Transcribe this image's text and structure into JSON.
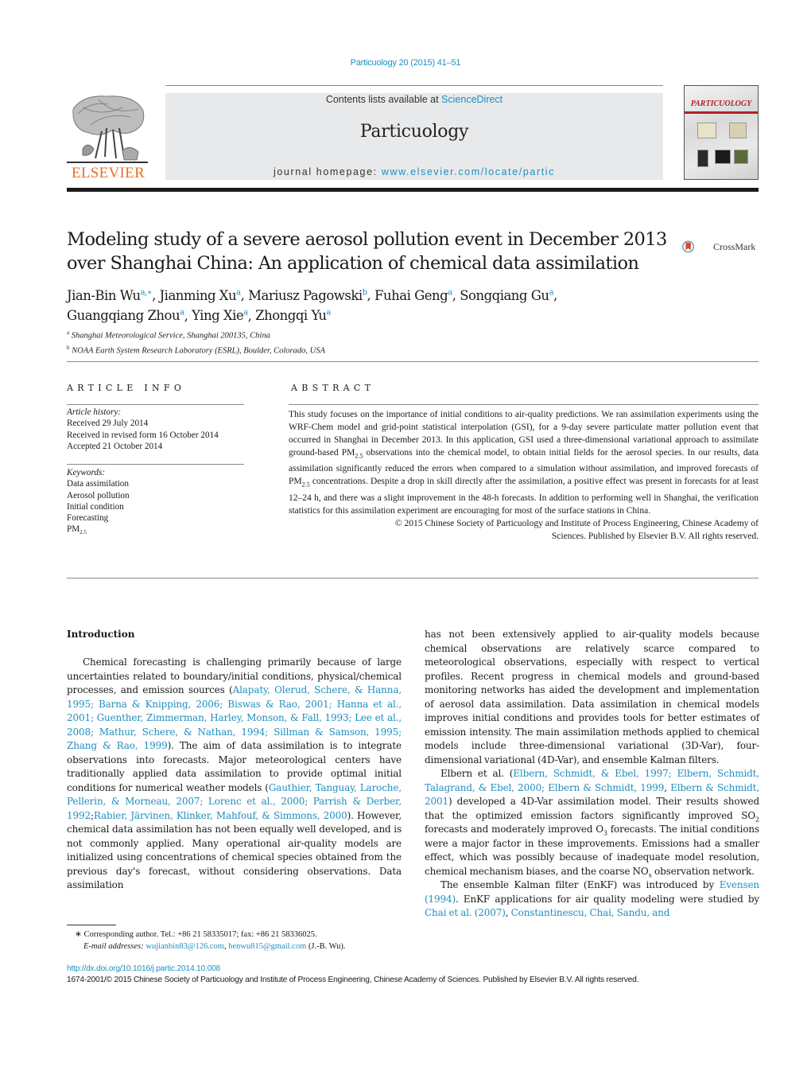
{
  "header": {
    "running_head": "Particuology 20 (2015) 41–51",
    "publisher_wordmark": "ELSEVIER",
    "publisher_logo_icon": "elsevier-tree-icon",
    "contents_prefix": "Contents lists available at ",
    "contents_link": "ScienceDirect",
    "journal_name": "Particuology",
    "homepage_prefix": "journal homepage: ",
    "homepage_link": "www.elsevier.com/locate/partic",
    "cover_title": "PARTICUOLOGY",
    "crossmark_label": "CrossMark"
  },
  "article": {
    "title_line1": "Modeling study of a severe aerosol pollution event in December 2013",
    "title_line2": "over Shanghai China: An application of chemical data assimilation",
    "authors": [
      {
        "name": "Jian-Bin Wu",
        "sup": "a,∗",
        "sep": ", "
      },
      {
        "name": "Jianming Xu",
        "sup": "a",
        "sep": ", "
      },
      {
        "name": "Mariusz Pagowski",
        "sup": "b",
        "sep": ", "
      },
      {
        "name": "Fuhai Geng",
        "sup": "a",
        "sep": ", "
      },
      {
        "name": "Songqiang Gu",
        "sup": "a",
        "sep": ","
      },
      {
        "name": "Guangqiang Zhou",
        "sup": "a",
        "sep": ", "
      },
      {
        "name": "Ying Xie",
        "sup": "a",
        "sep": ", "
      },
      {
        "name": "Zhongqi Yu",
        "sup": "a",
        "sep": ""
      }
    ],
    "affiliations": [
      {
        "mark": "a",
        "text": "Shanghai Meteorological Service, Shanghai 200135, China"
      },
      {
        "mark": "b",
        "text": "NOAA Earth System Research Laboratory (ESRL), Boulder, Colorado, USA"
      }
    ]
  },
  "article_info": {
    "heading": "ARTICLE INFO",
    "history_label": "Article history:",
    "history": [
      "Received 29 July 2014",
      "Received in revised form 16 October 2014",
      "Accepted 21 October 2014"
    ],
    "keywords_label": "Keywords:",
    "keywords": [
      "Data assimilation",
      "Aerosol pollution",
      "Initial condition",
      "Forecasting"
    ],
    "keyword_pm_base": "PM",
    "keyword_pm_sub": "2.5"
  },
  "abstract": {
    "heading": "ABSTRACT",
    "p1": "This study focuses on the importance of initial conditions to air-quality predictions. We ran assimilation experiments using the WRF-Chem model and grid-point statistical interpolation (GSI), for a 9-day severe particulate matter pollution event that occurred in Shanghai in December 2013. In this application, GSI used a three-dimensional variational approach to assimilate ground-based PM",
    "sub1": "2.5",
    "p2": " observations into the chemical model, to obtain initial fields for the aerosol species. In our results, data assimilation significantly reduced the errors when compared to a simulation without assimilation, and improved forecasts of PM",
    "sub2": "2.5",
    "p3": " concentrations. Despite a drop in skill directly after the assimilation, a positive effect was present in forecasts for at least 12–24 h, and there was a slight improvement in the 48-h forecasts. In addition to performing well in Shanghai, the verification statistics for this assimilation experiment are encouraging for most of the surface stations in China.",
    "copyright_line1": "© 2015 Chinese Society of Particuology and Institute of Process Engineering, Chinese Academy of",
    "copyright_line2": "Sciences. Published by Elsevier B.V. All rights reserved."
  },
  "body": {
    "section_heading": "Introduction",
    "left": {
      "t1": "Chemical forecasting is challenging primarily because of large uncertainties related to boundary/initial conditions, physical/chemical processes, and emission sources (",
      "c1": "Alapaty, Olerud, Schere, & Hanna, 1995; Barna & Knipping, 2006; Biswas & Rao, 2001; Hanna et al., 2001; Guenther, Zimmerman, Harley, Monson, & Fall, 1993; Lee et al., 2008; Mathur, Schere, & Nathan, 1994; Sillman & Samson, 1995; Zhang & Rao, 1999",
      "t2": "). The aim of data assimilation is to integrate observations into forecasts. Major meteorological centers have traditionally applied data assimilation to provide optimal initial conditions for numerical weather models (",
      "c2": "Gauthier, Tanguay, Laroche, Pellerin, & Morneau, 2007; Lorenc et al., 2000; Parrish & Derber, 1992",
      "t3": ";",
      "c3": "Rabier, Järvinen, Klinker, Mahfouf, & Simmons, 2000",
      "t4": "). However, chemical data assimilation has not been equally well developed, and is not commonly applied. Many operational air-quality models are initialized using concentrations of chemical species obtained from the previous day's forecast, without considering observations. Data assimilation"
    },
    "right": {
      "p1": "has not been extensively applied to air-quality models because chemical observations are relatively scarce compared to meteorological observations, especially with respect to vertical profiles. Recent progress in chemical models and ground-based monitoring networks has aided the development and implementation of aerosol data assimilation. Data assimilation in chemical models improves initial conditions and provides tools for better estimates of emission intensity. The main assimilation methods applied to chemical models include three-dimensional variational (3D-Var), four-dimensional variational (4D-Var), and ensemble Kalman filters.",
      "p2_t1": "Elbern et al. (",
      "p2_c1": "Elbern, Schmidt, & Ebel, 1997; Elbern, Schmidt, Talagrand, & Ebel, 2000; Elbern & Schmidt, 1999",
      "p2_t2": ", ",
      "p2_c2": "Elbern & Schmidt, 2001",
      "p2_t3": ") developed a 4D-Var assimilation model. Their results showed that the optimized emission factors significantly improved SO",
      "p2_sub1": "2",
      "p2_t4": " forecasts and moderately improved O",
      "p2_sub2": "3",
      "p2_t5": " forecasts. The initial conditions were a major factor in these improvements. Emissions had a smaller effect, which was possibly because of inadequate model resolution, chemical mechanism biases, and the coarse NO",
      "p2_sub3": "x",
      "p2_t6": " observation network.",
      "p3_t1": "The ensemble Kalman filter (EnKF) was introduced by ",
      "p3_c1": "Evensen (1994)",
      "p3_t2": ". EnKF applications for air quality modeling were studied by ",
      "p3_c2": "Chai et al. (2007)",
      "p3_t3": ", ",
      "p3_c3": "Constantinescu, Chai, Sandu, and"
    }
  },
  "footnote": {
    "mark": "∗",
    "corresponding": " Corresponding author. Tel.: +86 21 58335017; fax: +86 21 58336025.",
    "email_label": "E-mail addresses:",
    "email1": "wujianbin83@126.com",
    "email_sep": ", ",
    "email2": "benwu815@gmail.com",
    "email_suffix": " (J.-B. Wu)."
  },
  "footer": {
    "doi": "http://dx.doi.org/10.1016/j.partic.2014.10.008",
    "issn_line": "1674-2001/© 2015 Chinese Society of Particuology and Institute of Process Engineering, Chinese Academy of Sciences. Published by Elsevier B.V. All rights reserved."
  }
}
